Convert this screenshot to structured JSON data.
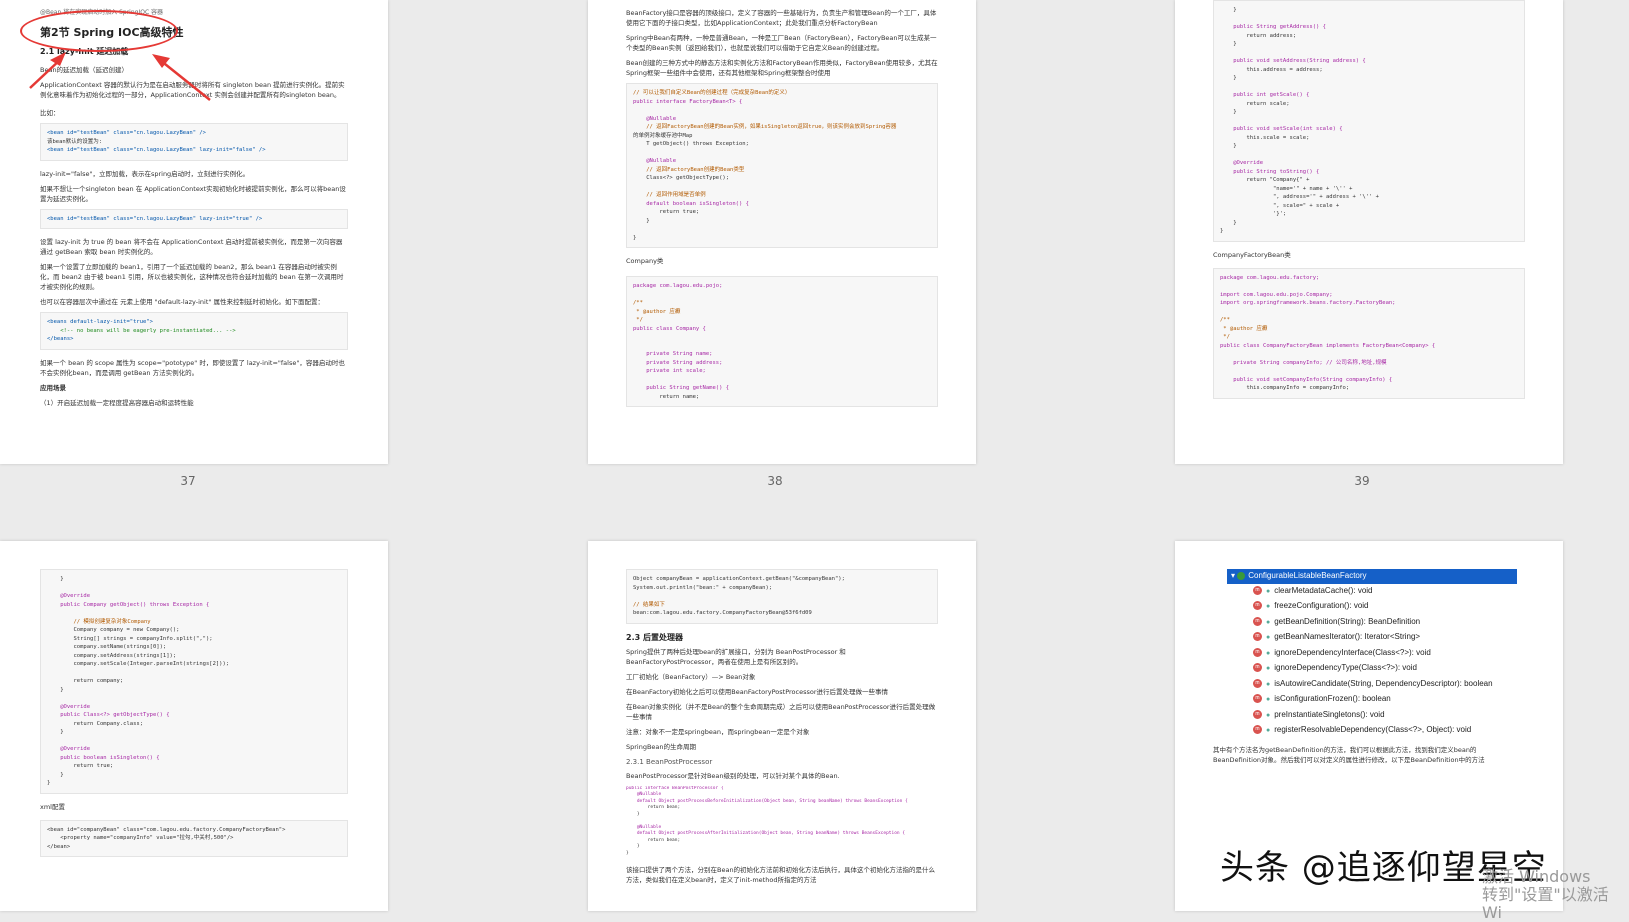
{
  "pages": [
    {
      "number": "37"
    },
    {
      "number": "38"
    },
    {
      "number": "39"
    },
    {
      "number": ""
    },
    {
      "number": ""
    },
    {
      "number": ""
    }
  ],
  "p37": {
    "top_line": "@Bean 将在实现启动时加入 SpringIOC 容器",
    "section_title": "第2节 Spring IOC高级特性",
    "sub_title": "2.1 lazy-Init 延迟加载",
    "sub_sub": "Bean的延迟加载（延迟创建）",
    "para1": "ApplicationContext 容器的默认行为是在启动服务器时将所有 singleton bean 提前进行实例化。提前实例化意味着作为初始化过程的一部分，ApplicationContext 实例会创建并配置所有的singleton bean。",
    "eg": "比如：",
    "code1_l1": "<bean id=\"testBean\" class=\"cn.lagou.LazyBean\" />",
    "code1_l2": "该bean默认的设置为:",
    "code1_l3": "<bean id=\"testBean\" class=\"cn.lagou.LazyBean\" lazy-init=\"false\" />",
    "para2": "lazy-init=\"false\"，立即加载，表示在spring启动时，立刻进行实例化。",
    "para3": "如果不想让一个singleton bean 在 ApplicationContext实现初始化时被提前实例化，那么可以将bean设置为延迟实例化。",
    "code2": "<bean id=\"testBean\" class=\"cn.lagou.LazyBean\" lazy-init=\"true\" />",
    "para4": "设置 lazy-init 为 true 的 bean 将不会在 ApplicationContext 启动时提前被实例化，而是第一次向容器通过 getBean 索取 bean 时实例化的。",
    "para5": "如果一个设置了立即加载的 bean1，引用了一个延迟加载的 bean2，那么 bean1 在容器启动时被实例化，而 bean2 由于被 bean1 引用，所以也被实例化，这种情况也符合延时加载的 bean 在第一次调用时才被实例化的规则。",
    "para6": "也可以在容器层次中通过在 元素上使用 \"default-lazy-init\" 属性来控制延时初始化。如下面配置：",
    "code3_l1": "<beans default-lazy-init=\"true\">",
    "code3_l2": "    <!-- no beans will be eagerly pre-instantiated... -->",
    "code3_l3": "</beans>",
    "para7": "如果一个 bean 的 scope 属性为 scope=\"pototype\" 时，即使设置了 lazy-init=\"false\"，容器启动时也不会实例化bean，而是调用 getBean 方法实例化的。",
    "scenario": "应用场景",
    "scenario1": "（1）开启延迟加载一定程度提高容器启动和运转性能"
  },
  "p38": {
    "para1": "BeanFactory接口是容器的顶级接口，定义了容器的一些基础行为，负责生产和管理Bean的一个工厂，具体使用它下面的子接口类型，比如ApplicationContext；此处我们重点分析FactoryBean",
    "para2": "Spring中Bean有两种，一种是普通Bean，一种是工厂Bean（FactoryBean），FactoryBean可以生成某一个类型的Bean实例（返回给我们），也就是说我们可以借助于它自定义Bean的创建过程。",
    "para3": "Bean创建的三种方式中的静态方法和实例化方法和FactoryBean作用类似，FactoryBean使用较多，尤其在Spring框架一些组件中会使用，还有其他框架和Spring框架整合时使用",
    "code1": [
      "// 可以让我们自定义Bean的创建过程（完成复杂Bean的定义）",
      "public interface FactoryBean<T> {",
      "",
      "    @Nullable",
      "    // 返回FactoryBean创建的Bean实例，如果isSingleton返回true，则该实例会放到Spring容器",
      "的单例对象缓存池中Map",
      "    T getObject() throws Exception;",
      "",
      "    @Nullable",
      "    // 返回FactoryBean创建的Bean类型",
      "    Class<?> getObjectType();",
      "",
      "    // 返回作用域是否单例",
      "    default boolean isSingleton() {",
      "        return true;",
      "    }",
      "",
      "}"
    ],
    "company_label": "Company类",
    "code2": [
      "package com.lagou.edu.pojo;",
      "",
      "/**",
      " * @author 应癫",
      " */",
      "public class Company {",
      "",
      "",
      "    private String name;",
      "    private String address;",
      "    private int scale;",
      "",
      "    public String getName() {",
      "        return name;"
    ]
  },
  "p39": {
    "code1": [
      "    }",
      "",
      "    public String getAddress() {",
      "        return address;",
      "    }",
      "",
      "    public void setAddress(String address) {",
      "        this.address = address;",
      "    }",
      "",
      "    public int getScale() {",
      "        return scale;",
      "    }",
      "",
      "    public void setScale(int scale) {",
      "        this.scale = scale;",
      "    }",
      "",
      "    @Override",
      "    public String toString() {",
      "        return \"Company{\" +",
      "                \"name='\" + name + '\\'' +",
      "                \", address='\" + address + '\\'' +",
      "                \", scale=\" + scale +",
      "                '}';",
      "    }",
      "}"
    ],
    "factory_label": "CompanyFactoryBean类",
    "code2": [
      "package com.lagou.edu.factory;",
      "",
      "import com.lagou.edu.pojo.Company;",
      "import org.springframework.beans.factory.FactoryBean;",
      "",
      "/**",
      " * @author 应癫",
      " */",
      "public class CompanyFactoryBean implements FactoryBean<Company> {",
      "",
      "    private String companyInfo; // 公司名称,地址,规模",
      "",
      "    public void setCompanyInfo(String companyInfo) {",
      "        this.companyInfo = companyInfo;"
    ]
  },
  "p40": {
    "code1": [
      "    }",
      "",
      "    @Override",
      "    public Company getObject() throws Exception {",
      "",
      "        // 模拟创建复杂对象Company",
      "        Company company = new Company();",
      "        String[] strings = companyInfo.split(\",\");",
      "        company.setName(strings[0]);",
      "        company.setAddress(strings[1]);",
      "        company.setScale(Integer.parseInt(strings[2]));",
      "",
      "        return company;",
      "    }",
      "",
      "    @Override",
      "    public Class<?> getObjectType() {",
      "        return Company.class;",
      "    }",
      "",
      "    @Override",
      "    public boolean isSingleton() {",
      "        return true;",
      "    }",
      "}"
    ],
    "xml_label": "xml配置",
    "code2": [
      "<bean id=\"companyBean\" class=\"com.lagou.edu.factory.CompanyFactoryBean\">",
      "    <property name=\"companyInfo\" value=\"拉勾,中关村,500\"/>",
      "</bean>"
    ]
  },
  "p41": {
    "code1": [
      "Object companyBean = applicationContext.getBean(\"&companyBean\");",
      "System.out.println(\"bean:\" + companyBean);",
      "",
      "// 结果如下",
      "bean:com.lagou.edu.factory.CompanyFactoryBean@53f6fd09"
    ],
    "h_post": "2.3 后置处理器",
    "para1": "Spring提供了两种后处理bean的扩展接口，分别为 BeanPostProcessor 和 BeanFactoryPostProcessor，两者在使用上是有所区别的。",
    "para2": "工厂初始化（BeanFactory）—> Bean对象",
    "para3": "在BeanFactory初始化之后可以使用BeanFactoryPostProcessor进行后置处理做一些事情",
    "para4": "在Bean对象实例化（并不是Bean的整个生命周期完成）之后可以使用BeanPostProcessor进行后置处理做一些事情",
    "para5": "注意：对象不一定是springbean，而springbean一定是个对象",
    "para6": "SpringBean的生命周期",
    "h_bpp": "2.3.1 BeanPostProcessor",
    "para7": "BeanPostProcessor是针对Bean级别的处理，可以针对某个具体的Bean.",
    "code2": [
      "public interface BeanPostProcessor {",
      "    @Nullable",
      "    default Object postProcessBeforeInitialization(Object bean, String beanName) throws BeansException {",
      "        return bean;",
      "    }",
      "",
      "    @Nullable",
      "    default Object postProcessAfterInitialization(Object bean, String beanName) throws BeansException {",
      "        return bean;",
      "    }",
      "}"
    ],
    "para8": "该接口提供了两个方法，分别在Bean的初始化方法前和初始化方法后执行，具体这个初始化方法指的是什么方法，类似我们在定义bean时，定义了init-method所指定的方法"
  },
  "p42": {
    "root": "ConfigurableListableBeanFactory",
    "methods": [
      "clearMetadataCache(): void",
      "freezeConfiguration(): void",
      "getBeanDefinition(String): BeanDefinition",
      "getBeanNamesIterator(): Iterator<String>",
      "ignoreDependencyInterface(Class<?>): void",
      "ignoreDependencyType(Class<?>): void",
      "isAutowireCandidate(String, DependencyDescriptor): boolean",
      "isConfigurationFrozen(): boolean",
      "preInstantiateSingletons(): void",
      "registerResolvableDependency(Class<?>, Object): void"
    ],
    "para1": "其中有个方法名为getBeanDefinition的方法，我们可以根据此方法，找到我们定义bean的 BeanDefinition对象。然后我们可以对定义的属性进行修改，以下是BeanDefinition中的方法"
  },
  "overlay": {
    "watermark": "头条 @追逐仰望星空",
    "activate_line1": "激活 Windows",
    "activate_line2": "转到\"设置\"以激活 Wi"
  },
  "colors": {
    "annotation": "#e53935",
    "tree_selected": "#1560c8",
    "background": "#ebebeb"
  }
}
